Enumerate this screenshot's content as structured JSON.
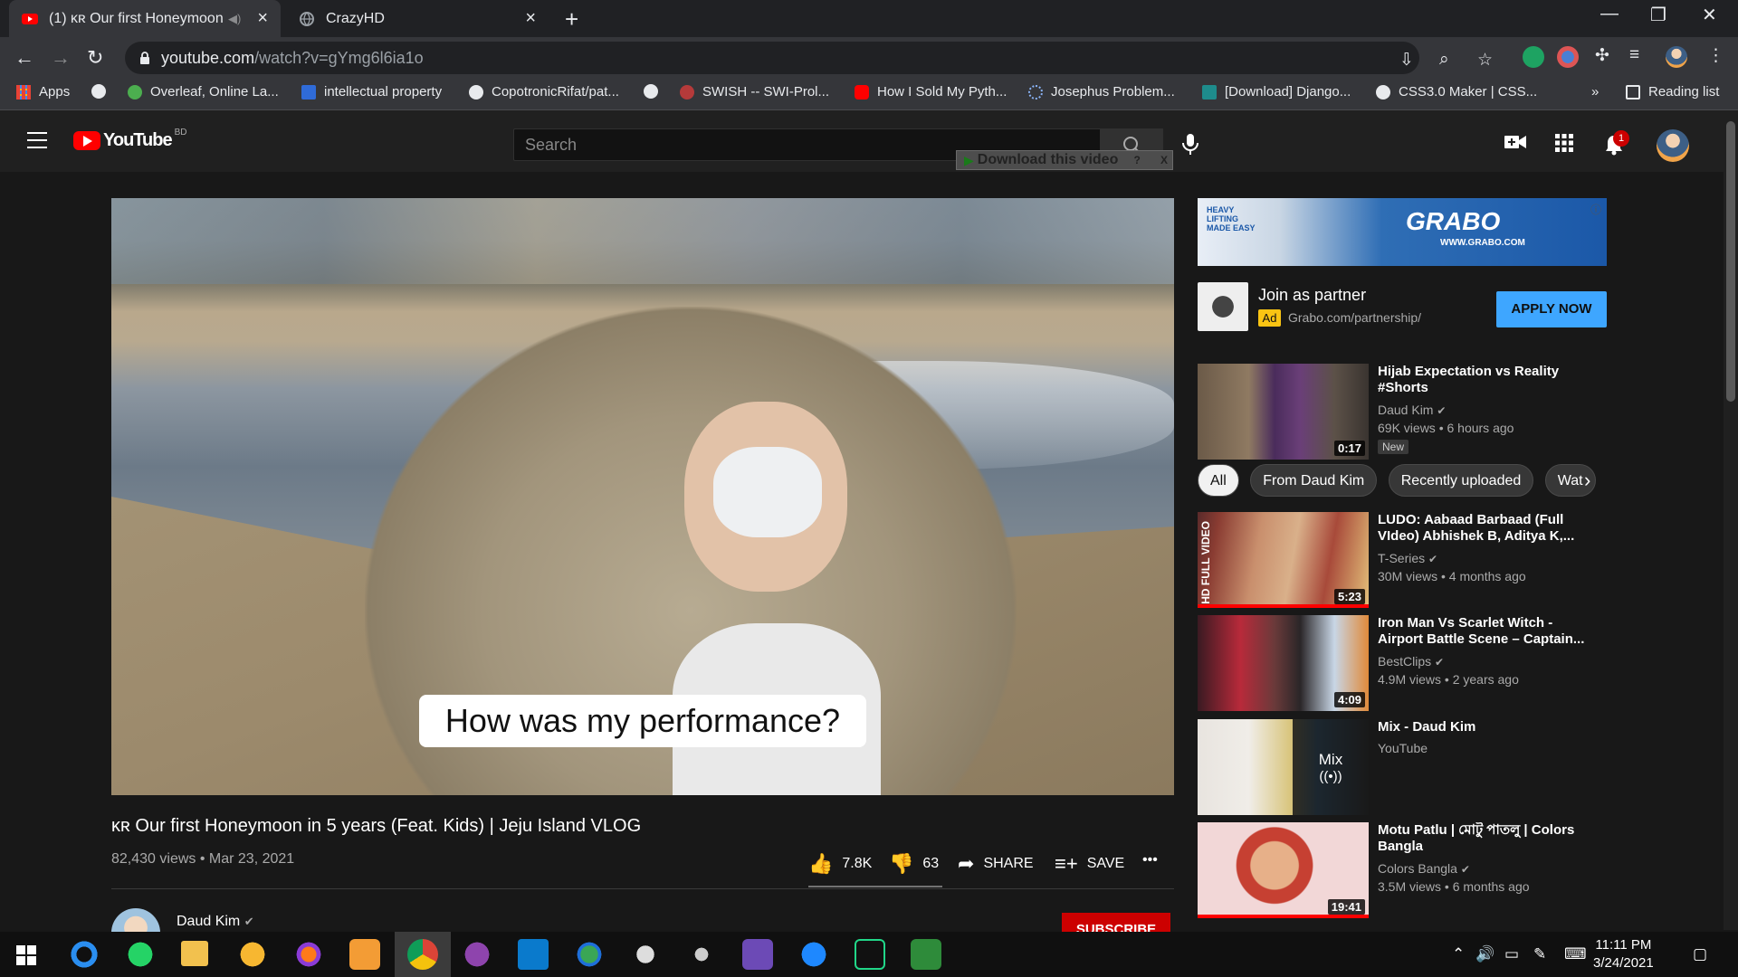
{
  "browser": {
    "tabs": [
      {
        "label": "(1) 🇰🇷 Our first Honeymoon in 5 years (Feat. Kids) | Jeju Island VLOG - YouTube",
        "display": "(1) ᴋʀ Our first Honeymoon ir",
        "active": true
      },
      {
        "label": "CrazyHD",
        "display": "CrazyHD",
        "active": false
      }
    ],
    "url_host": "youtube.com",
    "url_path": "/watch?v=gYmg6l6ia1o",
    "bookmarks": [
      {
        "label": "Apps",
        "icon": "apps-grid-icon"
      },
      {
        "label": "",
        "icon": "globe-icon"
      },
      {
        "label": "Overleaf, Online La...",
        "icon": "overleaf-icon"
      },
      {
        "label": "intellectual property",
        "icon": "bookmark-s-icon"
      },
      {
        "label": "CopotronicRifat/pat...",
        "icon": "github-icon"
      },
      {
        "label": "",
        "icon": "globe-icon"
      },
      {
        "label": "SWISH -- SWI-Prol...",
        "icon": "swish-icon"
      },
      {
        "label": "How I Sold My Pyth...",
        "icon": "youtube-icon"
      },
      {
        "label": "Josephus Problem...",
        "icon": "loading-icon"
      },
      {
        "label": "[Download] Django...",
        "icon": "django-icon"
      },
      {
        "label": "CSS3.0 Maker | CSS...",
        "icon": "globe-icon"
      }
    ],
    "bookmarks_more": "»",
    "reading_list": "Reading list"
  },
  "header": {
    "logo_text": "YouTube",
    "country_code": "BD",
    "search_placeholder": "Search",
    "download_bar": "Download this video",
    "download_help": "?",
    "download_close": "X",
    "notification_count": "1"
  },
  "video": {
    "caption": "How was my performance?",
    "title": "ᴋʀ Our first Honeymoon in 5 years (Feat. Kids) | Jeju Island VLOG",
    "views": "82,430 views",
    "date": "Mar 23, 2021",
    "likes": "7.8K",
    "dislikes": "63",
    "share_label": "SHARE",
    "save_label": "SAVE",
    "more_label": "•••",
    "channel_name": "Daud Kim",
    "subscribe_label": "SUBSCRIBE"
  },
  "ad": {
    "banner_brand": "GRABO",
    "banner_tagline": "HEAVY LIFTING MADE EASY",
    "banner_url": "WWW.GRABO.COM",
    "title": "Join as partner",
    "badge": "Ad",
    "url": "Grabo.com/partnership/",
    "cta": "APPLY NOW"
  },
  "first_rec": {
    "title": "Hijab Expectation vs Reality #Shorts",
    "channel": "Daud Kim",
    "meta": "69K views • 6 hours ago",
    "badge": "New",
    "duration": "0:17"
  },
  "chips": [
    "All",
    "From Daud Kim",
    "Recently uploaded",
    "Wat"
  ],
  "recommendations": [
    {
      "title": "LUDO: Aabaad Barbaad (Full VIdeo) Abhishek B, Aditya K,...",
      "channel": "T-Series",
      "meta": "30M views • 4 months ago",
      "duration": "5:23",
      "watched": 1.0
    },
    {
      "title": "Iron Man Vs Scarlet Witch - Airport Battle Scene – Captain...",
      "channel": "BestClips",
      "meta": "4.9M views • 2 years ago",
      "duration": "4:09",
      "watched": 0
    },
    {
      "title": "Mix - Daud Kim",
      "channel": "YouTube",
      "meta": "",
      "duration": "",
      "mix_label": "Mix",
      "watched": 0
    },
    {
      "title": "Motu Patlu | মোটু পাতলু | Colors Bangla",
      "channel": "Colors Bangla",
      "meta": "3.5M views • 6 months ago",
      "duration": "19:41",
      "watched": 1.0
    }
  ],
  "taskbar": {
    "time": "11:11 PM",
    "date": "3/24/2021"
  }
}
